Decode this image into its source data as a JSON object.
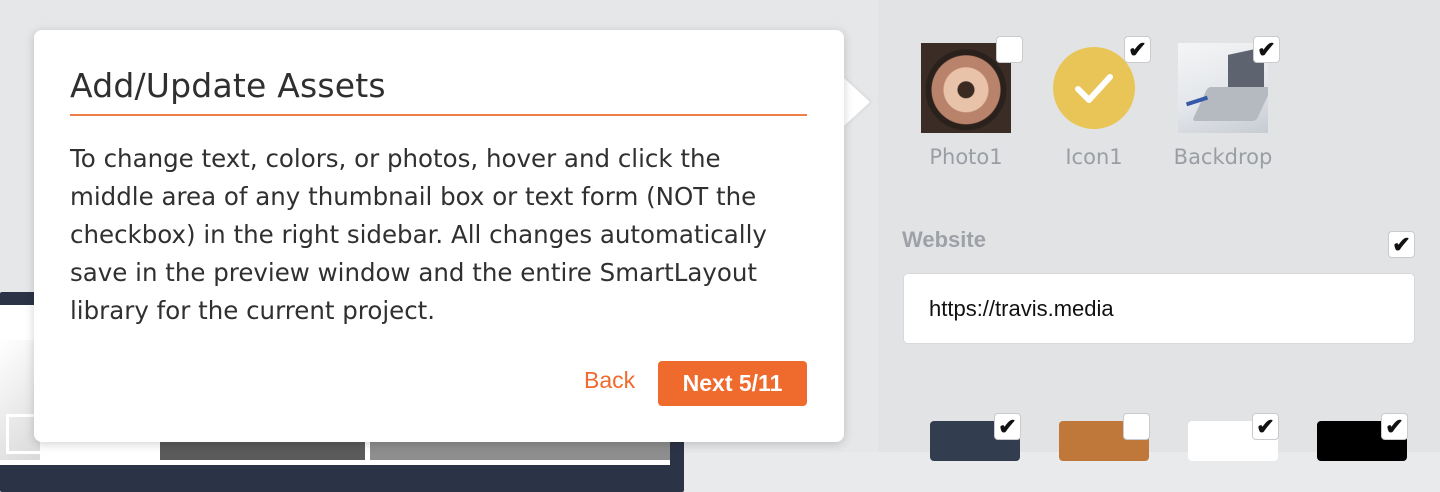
{
  "popover": {
    "title": "Add/Update Assets",
    "body": "To change text, colors, or photos, hover and click the middle area of any thumbnail box or text form (NOT the checkbox) in the right sidebar. All changes automatically save in the preview window and the entire SmartLayout library for the current project.",
    "back_label": "Back",
    "next_label": "Next 5/11"
  },
  "sidebar": {
    "assets": [
      {
        "label": "Photo1",
        "checked": false,
        "icon": "pottery-photo"
      },
      {
        "label": "Icon1",
        "checked": true,
        "icon": "checkmark-icon"
      },
      {
        "label": "Backdrop",
        "checked": true,
        "icon": "laptop-photo"
      }
    ],
    "website": {
      "label": "Website",
      "value": "https://travis.media",
      "checked": true
    },
    "swatches": [
      {
        "color": "#333d50",
        "checked": true
      },
      {
        "color": "#c0773a",
        "checked": false
      },
      {
        "color": "#ffffff",
        "checked": true
      },
      {
        "color": "#000000",
        "checked": true
      }
    ]
  },
  "colors": {
    "accent": "#ef6a2d",
    "icon_yellow": "#e8c556"
  }
}
